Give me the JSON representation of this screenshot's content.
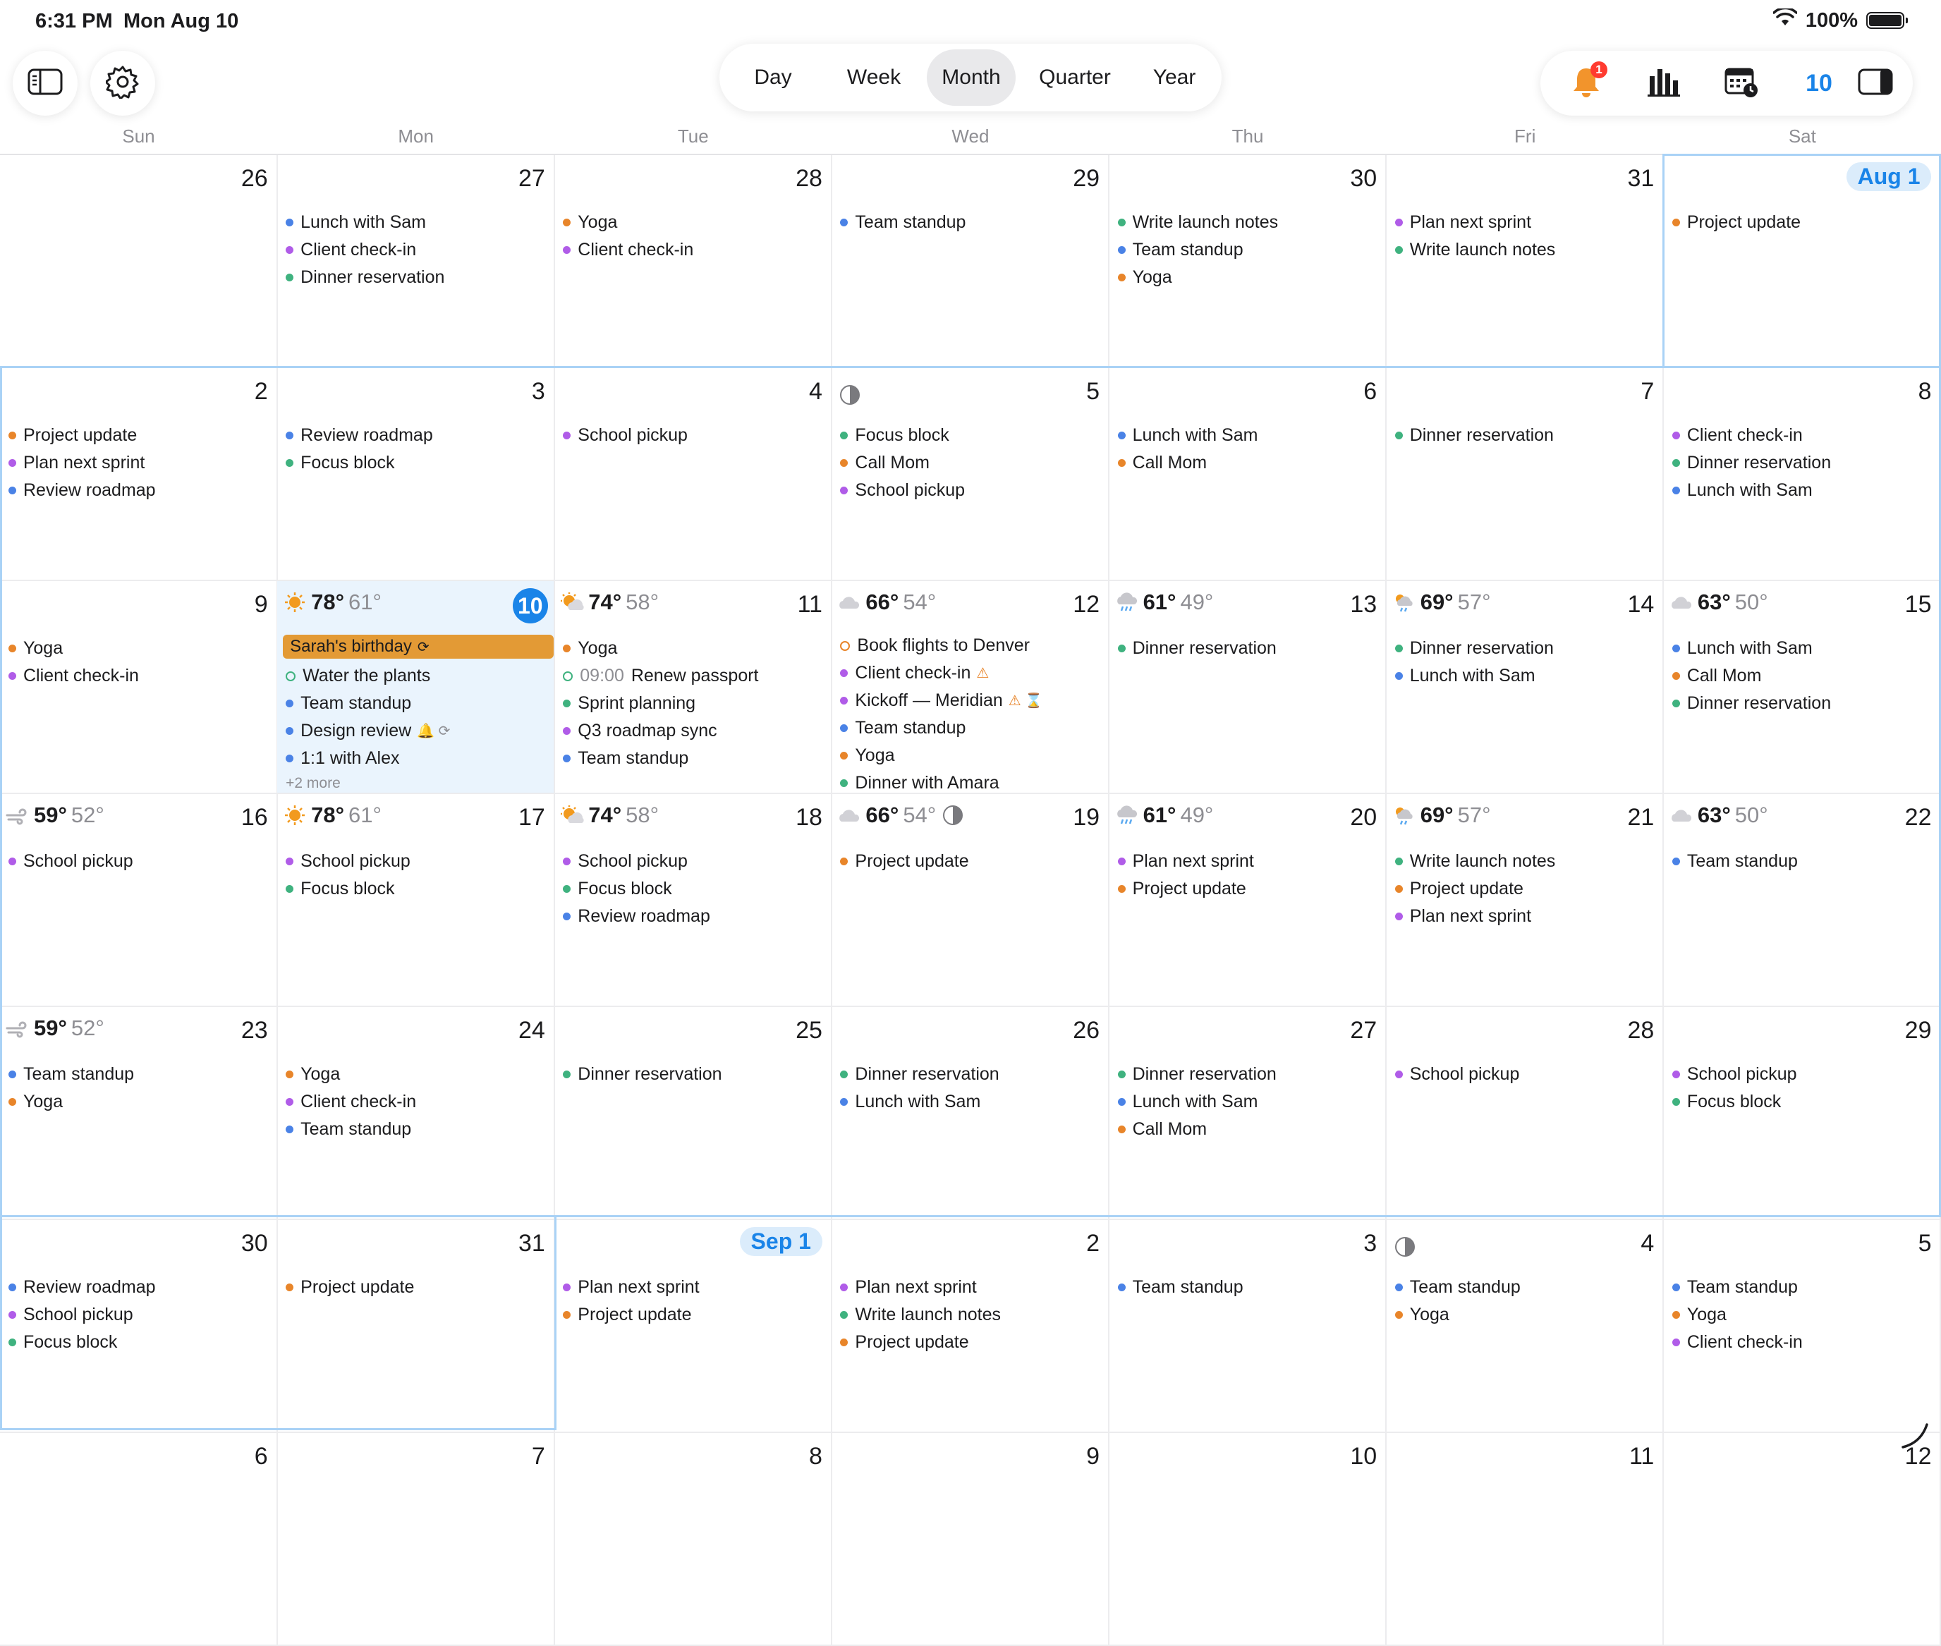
{
  "status_bar": {
    "time": "6:31 PM",
    "date": "Mon Aug 10",
    "battery": "100%"
  },
  "toolbar": {
    "view_modes": [
      {
        "label": "Day",
        "active": false
      },
      {
        "label": "Week",
        "active": false
      },
      {
        "label": "Month",
        "active": true
      },
      {
        "label": "Quarter",
        "active": false
      },
      {
        "label": "Year",
        "active": false
      }
    ],
    "notification_badge": "1",
    "today_label": "10"
  },
  "colors": {
    "accent": "#1a84e8",
    "orange": "#e8852a",
    "purple": "#b05ce8",
    "green": "#3fb27f",
    "blue": "#4a82e6",
    "allday": "#e39a35"
  },
  "weekdays": [
    "Sun",
    "Mon",
    "Tue",
    "Wed",
    "Thu",
    "Fri",
    "Sat"
  ],
  "weeks": [
    [
      {
        "day": "26",
        "events": []
      },
      {
        "day": "27",
        "events": [
          {
            "title": "Lunch with Sam",
            "color": "blue"
          },
          {
            "title": "Client check-in",
            "color": "purple"
          },
          {
            "title": "Dinner reservation",
            "color": "green"
          }
        ]
      },
      {
        "day": "28",
        "events": [
          {
            "title": "Yoga",
            "color": "orange"
          },
          {
            "title": "Client check-in",
            "color": "purple"
          }
        ]
      },
      {
        "day": "29",
        "events": [
          {
            "title": "Team standup",
            "color": "blue"
          }
        ]
      },
      {
        "day": "30",
        "events": [
          {
            "title": "Write launch notes",
            "color": "green"
          },
          {
            "title": "Team standup",
            "color": "blue"
          },
          {
            "title": "Yoga",
            "color": "orange"
          }
        ]
      },
      {
        "day": "31",
        "events": [
          {
            "title": "Plan next sprint",
            "color": "purple"
          },
          {
            "title": "Write launch notes",
            "color": "green"
          }
        ]
      },
      {
        "day": "Aug 1",
        "style": "pill",
        "events": [
          {
            "title": "Project update",
            "color": "orange"
          }
        ]
      }
    ],
    [
      {
        "day": "2",
        "events": [
          {
            "title": "Project update",
            "color": "orange"
          },
          {
            "title": "Plan next sprint",
            "color": "purple"
          },
          {
            "title": "Review roadmap",
            "color": "blue"
          }
        ]
      },
      {
        "day": "3",
        "events": [
          {
            "title": "Review roadmap",
            "color": "blue"
          },
          {
            "title": "Focus block",
            "color": "green"
          }
        ]
      },
      {
        "day": "4",
        "events": [
          {
            "title": "School pickup",
            "color": "purple"
          }
        ]
      },
      {
        "day": "5",
        "moon": true,
        "events": [
          {
            "title": "Focus block",
            "color": "green"
          },
          {
            "title": "Call Mom",
            "color": "orange"
          },
          {
            "title": "School pickup",
            "color": "purple"
          }
        ]
      },
      {
        "day": "6",
        "events": [
          {
            "title": "Lunch with Sam",
            "color": "blue"
          },
          {
            "title": "Call Mom",
            "color": "orange"
          }
        ]
      },
      {
        "day": "7",
        "events": [
          {
            "title": "Dinner reservation",
            "color": "green"
          }
        ]
      },
      {
        "day": "8",
        "events": [
          {
            "title": "Client check-in",
            "color": "purple"
          },
          {
            "title": "Dinner reservation",
            "color": "green"
          },
          {
            "title": "Lunch with Sam",
            "color": "blue"
          }
        ]
      }
    ],
    [
      {
        "day": "9",
        "events": [
          {
            "title": "Yoga",
            "color": "orange"
          },
          {
            "title": "Client check-in",
            "color": "purple"
          }
        ]
      },
      {
        "day": "10",
        "style": "circle",
        "today": true,
        "weather": {
          "icon": "sun",
          "hi": "78°",
          "lo": "61°"
        },
        "allday": "Sarah's birthday",
        "events": [
          {
            "title": "Water the plants",
            "color": "green",
            "task": true
          },
          {
            "title": "Team standup",
            "color": "blue"
          },
          {
            "title": "Design review",
            "color": "blue",
            "tag": "🔔 ⟳"
          },
          {
            "title": "1:1 with Alex",
            "color": "blue"
          }
        ],
        "more": "+2 more"
      },
      {
        "day": "11",
        "weather": {
          "icon": "partly-sunny",
          "hi": "74°",
          "lo": "58°"
        },
        "events": [
          {
            "title": "Yoga",
            "color": "orange"
          },
          {
            "title": "Renew passport",
            "color": "green",
            "task": true,
            "time": "09:00"
          },
          {
            "title": "Sprint planning",
            "color": "green"
          },
          {
            "title": "Q3 roadmap sync",
            "color": "purple"
          },
          {
            "title": "Team standup",
            "color": "blue"
          }
        ]
      },
      {
        "day": "12",
        "weather": {
          "icon": "cloud",
          "hi": "66°",
          "lo": "54°"
        },
        "events": [
          {
            "title": "Book flights to Denver",
            "color": "orange",
            "task": true
          },
          {
            "title": "Client check-in",
            "color": "purple",
            "warn": "⚠"
          },
          {
            "title": "Kickoff — Meridian",
            "color": "purple",
            "warn": "⚠ ⌛"
          },
          {
            "title": "Team standup",
            "color": "blue"
          },
          {
            "title": "Yoga",
            "color": "orange"
          },
          {
            "title": "Dinner with Amara",
            "color": "green"
          }
        ]
      },
      {
        "day": "13",
        "weather": {
          "icon": "rain",
          "hi": "61°",
          "lo": "49°"
        },
        "events": [
          {
            "title": "Dinner reservation",
            "color": "green"
          }
        ]
      },
      {
        "day": "14",
        "weather": {
          "icon": "sun-rain",
          "hi": "69°",
          "lo": "57°"
        },
        "events": [
          {
            "title": "Dinner reservation",
            "color": "green"
          },
          {
            "title": "Lunch with Sam",
            "color": "blue"
          }
        ]
      },
      {
        "day": "15",
        "weather": {
          "icon": "cloud",
          "hi": "63°",
          "lo": "50°"
        },
        "events": [
          {
            "title": "Lunch with Sam",
            "color": "blue"
          },
          {
            "title": "Call Mom",
            "color": "orange"
          },
          {
            "title": "Dinner reservation",
            "color": "green"
          }
        ]
      }
    ],
    [
      {
        "day": "16",
        "weather": {
          "icon": "wind",
          "hi": "59°",
          "lo": "52°"
        },
        "events": [
          {
            "title": "School pickup",
            "color": "purple"
          }
        ]
      },
      {
        "day": "17",
        "weather": {
          "icon": "sun",
          "hi": "78°",
          "lo": "61°"
        },
        "events": [
          {
            "title": "School pickup",
            "color": "purple"
          },
          {
            "title": "Focus block",
            "color": "green"
          }
        ]
      },
      {
        "day": "18",
        "weather": {
          "icon": "partly-sunny",
          "hi": "74°",
          "lo": "58°"
        },
        "events": [
          {
            "title": "School pickup",
            "color": "purple"
          },
          {
            "title": "Focus block",
            "color": "green"
          },
          {
            "title": "Review roadmap",
            "color": "blue"
          }
        ]
      },
      {
        "day": "19",
        "weather": {
          "icon": "cloud",
          "hi": "66°",
          "lo": "54°",
          "moon": true
        },
        "events": [
          {
            "title": "Project update",
            "color": "orange"
          }
        ]
      },
      {
        "day": "20",
        "weather": {
          "icon": "rain",
          "hi": "61°",
          "lo": "49°"
        },
        "events": [
          {
            "title": "Plan next sprint",
            "color": "purple"
          },
          {
            "title": "Project update",
            "color": "orange"
          }
        ]
      },
      {
        "day": "21",
        "weather": {
          "icon": "sun-rain",
          "hi": "69°",
          "lo": "57°"
        },
        "events": [
          {
            "title": "Write launch notes",
            "color": "green"
          },
          {
            "title": "Project update",
            "color": "orange"
          },
          {
            "title": "Plan next sprint",
            "color": "purple"
          }
        ]
      },
      {
        "day": "22",
        "weather": {
          "icon": "cloud",
          "hi": "63°",
          "lo": "50°"
        },
        "events": [
          {
            "title": "Team standup",
            "color": "blue"
          }
        ]
      }
    ],
    [
      {
        "day": "23",
        "weather": {
          "icon": "wind",
          "hi": "59°",
          "lo": "52°"
        },
        "events": [
          {
            "title": "Team standup",
            "color": "blue"
          },
          {
            "title": "Yoga",
            "color": "orange"
          }
        ]
      },
      {
        "day": "24",
        "events": [
          {
            "title": "Yoga",
            "color": "orange"
          },
          {
            "title": "Client check-in",
            "color": "purple"
          },
          {
            "title": "Team standup",
            "color": "blue"
          }
        ]
      },
      {
        "day": "25",
        "events": [
          {
            "title": "Dinner reservation",
            "color": "green"
          }
        ]
      },
      {
        "day": "26",
        "events": [
          {
            "title": "Dinner reservation",
            "color": "green"
          },
          {
            "title": "Lunch with Sam",
            "color": "blue"
          }
        ]
      },
      {
        "day": "27",
        "events": [
          {
            "title": "Dinner reservation",
            "color": "green"
          },
          {
            "title": "Lunch with Sam",
            "color": "blue"
          },
          {
            "title": "Call Mom",
            "color": "orange"
          }
        ]
      },
      {
        "day": "28",
        "events": [
          {
            "title": "School pickup",
            "color": "purple"
          }
        ]
      },
      {
        "day": "29",
        "events": [
          {
            "title": "School pickup",
            "color": "purple"
          },
          {
            "title": "Focus block",
            "color": "green"
          }
        ]
      }
    ],
    [
      {
        "day": "30",
        "events": [
          {
            "title": "Review roadmap",
            "color": "blue"
          },
          {
            "title": "School pickup",
            "color": "purple"
          },
          {
            "title": "Focus block",
            "color": "green"
          }
        ]
      },
      {
        "day": "31",
        "events": [
          {
            "title": "Project update",
            "color": "orange"
          }
        ]
      },
      {
        "day": "Sep 1",
        "style": "pill",
        "events": [
          {
            "title": "Plan next sprint",
            "color": "purple"
          },
          {
            "title": "Project update",
            "color": "orange"
          }
        ]
      },
      {
        "day": "2",
        "events": [
          {
            "title": "Plan next sprint",
            "color": "purple"
          },
          {
            "title": "Write launch notes",
            "color": "green"
          },
          {
            "title": "Project update",
            "color": "orange"
          }
        ]
      },
      {
        "day": "3",
        "events": [
          {
            "title": "Team standup",
            "color": "blue"
          }
        ]
      },
      {
        "day": "4",
        "moon": true,
        "events": [
          {
            "title": "Team standup",
            "color": "blue"
          },
          {
            "title": "Yoga",
            "color": "orange"
          }
        ]
      },
      {
        "day": "5",
        "events": [
          {
            "title": "Team standup",
            "color": "blue"
          },
          {
            "title": "Yoga",
            "color": "orange"
          },
          {
            "title": "Client check-in",
            "color": "purple"
          }
        ]
      }
    ],
    [
      {
        "day": "6",
        "events": []
      },
      {
        "day": "7",
        "events": []
      },
      {
        "day": "8",
        "events": []
      },
      {
        "day": "9",
        "events": []
      },
      {
        "day": "10",
        "events": []
      },
      {
        "day": "11",
        "events": []
      },
      {
        "day": "12",
        "events": []
      }
    ]
  ]
}
